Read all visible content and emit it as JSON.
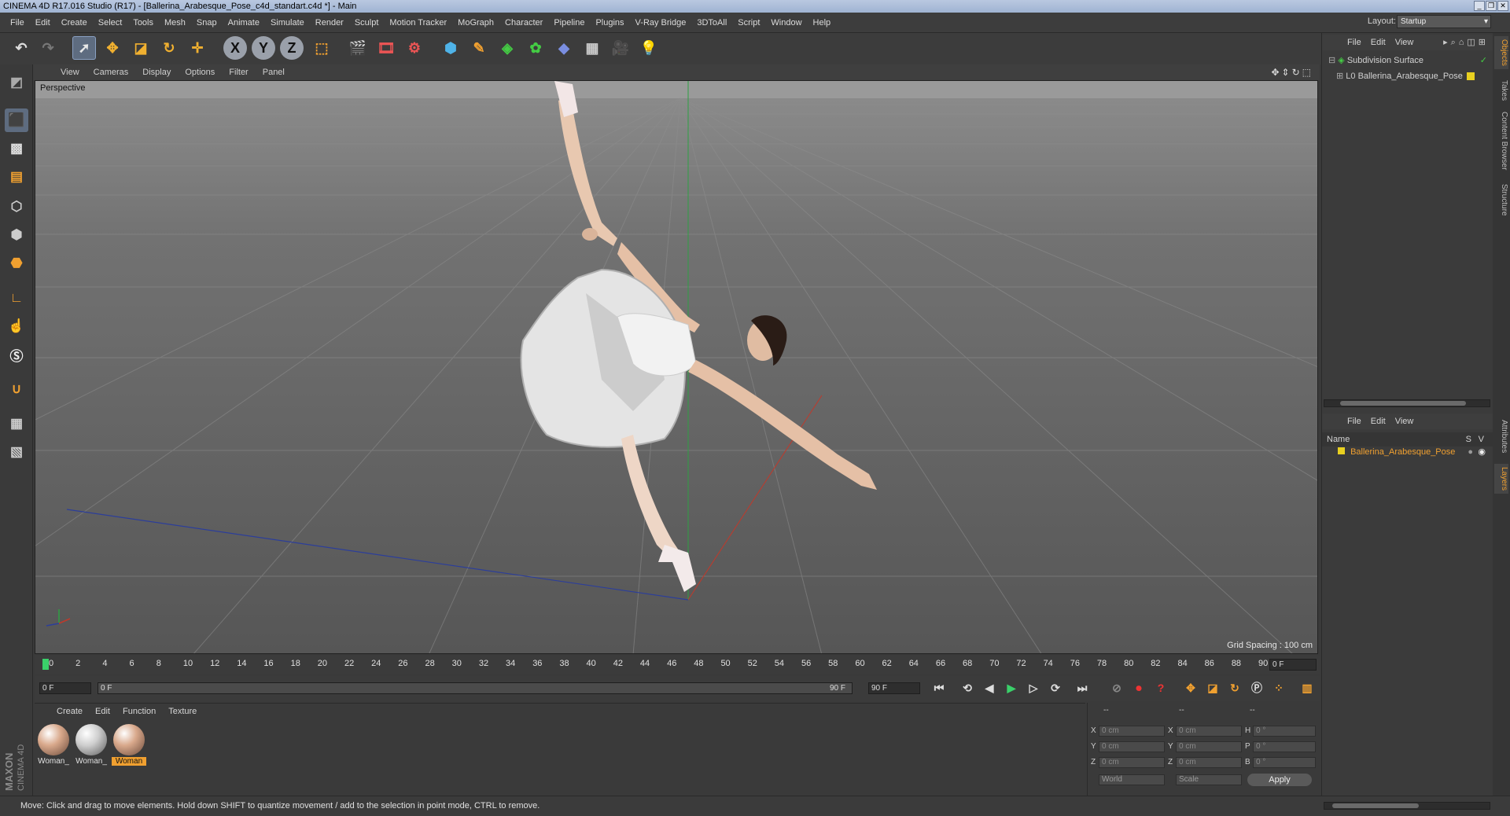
{
  "window": {
    "title": "CINEMA 4D R17.016 Studio (R17) - [Ballerina_Arabesque_Pose_c4d_standart.c4d *] - Main",
    "buttons": [
      "_",
      "❐",
      "✕"
    ]
  },
  "menubar": [
    "File",
    "Edit",
    "Create",
    "Select",
    "Tools",
    "Mesh",
    "Snap",
    "Animate",
    "Simulate",
    "Render",
    "Sculpt",
    "Motion Tracker",
    "MoGraph",
    "Character",
    "Pipeline",
    "Plugins",
    "V-Ray Bridge",
    "3DToAll",
    "Script",
    "Window",
    "Help"
  ],
  "layout": {
    "label": "Layout:",
    "value": "Startup"
  },
  "viewport": {
    "menu": [
      "View",
      "Cameras",
      "Display",
      "Options",
      "Filter",
      "Panel"
    ],
    "camera_label": "Perspective",
    "grid_spacing": "Grid Spacing : 100 cm"
  },
  "timeline": {
    "ticks": [
      "0",
      "2",
      "4",
      "6",
      "8",
      "10",
      "12",
      "14",
      "16",
      "18",
      "20",
      "22",
      "24",
      "26",
      "28",
      "30",
      "32",
      "34",
      "36",
      "38",
      "40",
      "42",
      "44",
      "46",
      "48",
      "50",
      "52",
      "54",
      "56",
      "58",
      "60",
      "62",
      "64",
      "66",
      "68",
      "70",
      "72",
      "74",
      "76",
      "78",
      "80",
      "82",
      "84",
      "86",
      "88",
      "90"
    ],
    "current_frame": "0 F",
    "start_frame": "0 F",
    "range_start": "0 F",
    "range_end": "90 F",
    "end_frame": "90 F"
  },
  "materials": {
    "menu": [
      "Create",
      "Edit",
      "Function",
      "Texture"
    ],
    "items": [
      {
        "label": "Woman_",
        "selected": false,
        "color": "skin"
      },
      {
        "label": "Woman_",
        "selected": false,
        "color": "white"
      },
      {
        "label": "Woman",
        "selected": true,
        "color": "skin"
      }
    ]
  },
  "coordinates": {
    "headers": [
      "--",
      "--",
      "--"
    ],
    "rows": [
      {
        "a": "X",
        "av": "0 cm",
        "b": "X",
        "bv": "0 cm",
        "c": "H",
        "cv": "0 °"
      },
      {
        "a": "Y",
        "av": "0 cm",
        "b": "Y",
        "bv": "0 cm",
        "c": "P",
        "cv": "0 °"
      },
      {
        "a": "Z",
        "av": "0 cm",
        "b": "Z",
        "bv": "0 cm",
        "c": "B",
        "cv": "0 °"
      }
    ],
    "mode1": "World",
    "mode2": "Scale",
    "apply": "Apply"
  },
  "objects": {
    "menu": [
      "File",
      "Edit",
      "View"
    ],
    "items": [
      {
        "name": "Subdivision Surface"
      },
      {
        "name": "Ballerina_Arabesque_Pose"
      }
    ]
  },
  "layers": {
    "menu": [
      "File",
      "Edit",
      "View"
    ],
    "header_name": "Name",
    "header_s": "S",
    "header_v": "V",
    "items": [
      {
        "name": "Ballerina_Arabesque_Pose"
      }
    ]
  },
  "sidetabs": [
    "Objects",
    "Takes",
    "Content Browser",
    "Structure",
    "Attributes",
    "Layers"
  ],
  "brand": {
    "maxon": "MAXON",
    "product": "CINEMA 4D"
  },
  "status": "Move: Click and drag to move elements. Hold down SHIFT to quantize movement / add to the selection in point mode, CTRL to remove.",
  "colors": {
    "accent": "#f0a030",
    "axis_x": "#c0392b",
    "axis_y": "#27ae60",
    "axis_z": "#2c3e9a",
    "selected": "#5e6c80"
  }
}
